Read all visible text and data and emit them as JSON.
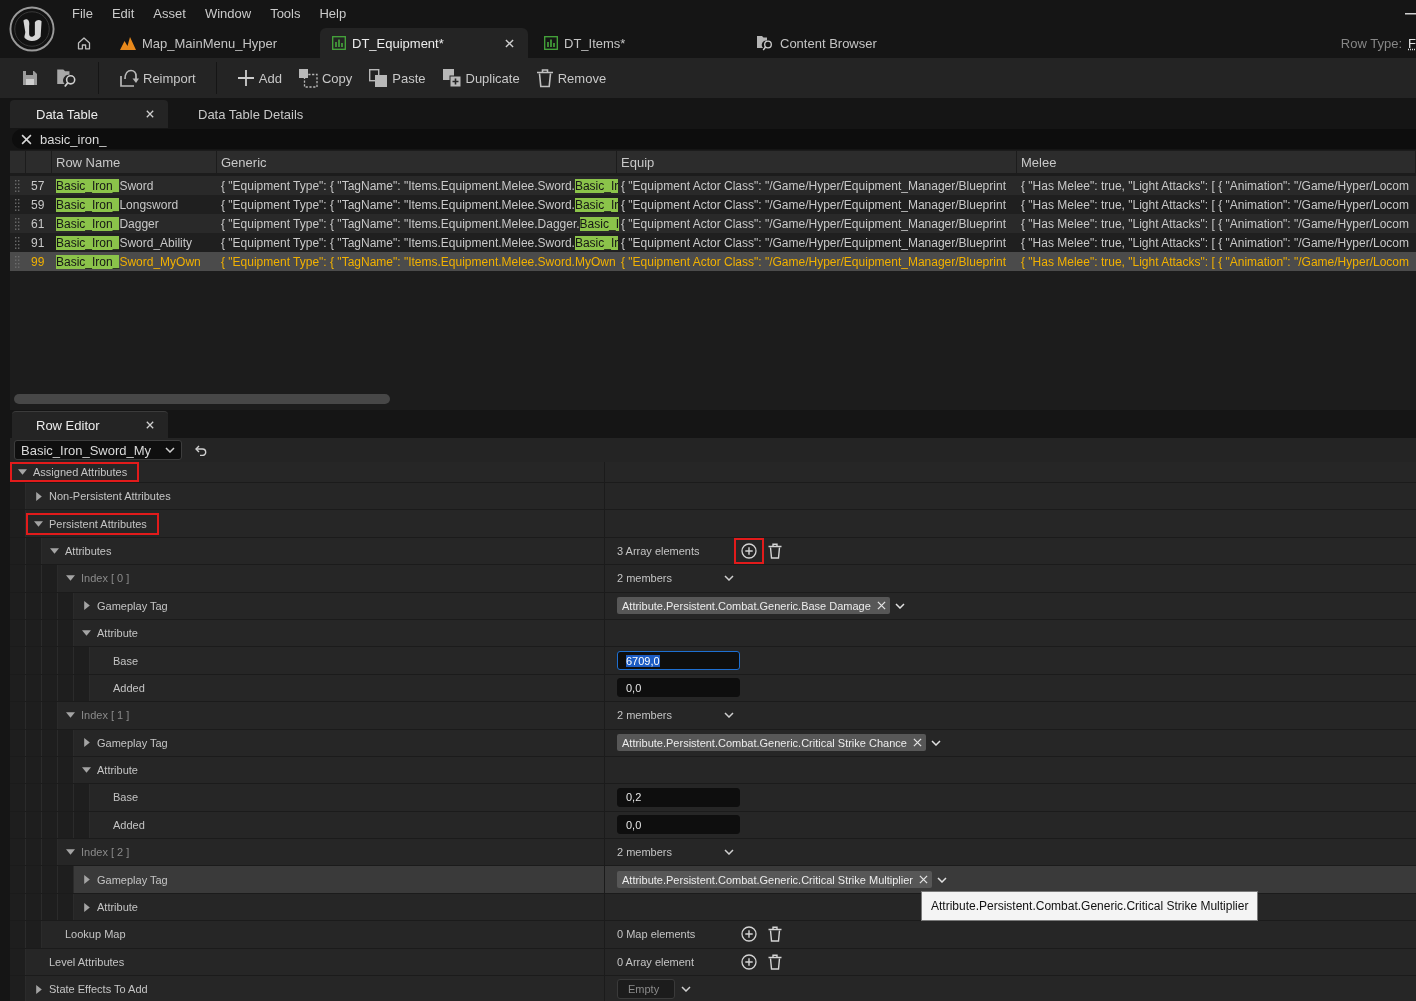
{
  "menu": [
    "File",
    "Edit",
    "Asset",
    "Window",
    "Tools",
    "Help"
  ],
  "document_tabs": [
    {
      "label": "Map_MainMenu_Hyper",
      "kind": "level",
      "selected": false
    },
    {
      "label": "DT_Equipment*",
      "kind": "data_table",
      "selected": true
    },
    {
      "label": "DT_Items*",
      "kind": "data_table",
      "selected": false
    },
    {
      "label": "Content Browser",
      "kind": "browser",
      "selected": false
    }
  ],
  "row_type": {
    "label": "Row Type:",
    "value": "F"
  },
  "toolbar": {
    "groups": [
      [
        {
          "kind": "save"
        },
        {
          "kind": "browse"
        }
      ],
      [
        {
          "kind": "reimport",
          "label": "Reimport"
        }
      ],
      [
        {
          "kind": "add",
          "label": "Add"
        },
        {
          "kind": "copy",
          "label": "Copy"
        },
        {
          "kind": "paste",
          "label": "Paste"
        },
        {
          "kind": "duplicate",
          "label": "Duplicate"
        },
        {
          "kind": "remove",
          "label": "Remove"
        }
      ]
    ]
  },
  "panel_tabs": [
    {
      "label": "Data Table",
      "selected": true
    },
    {
      "label": "Data Table Details",
      "selected": false
    }
  ],
  "search": {
    "value": "basic_iron_"
  },
  "table": {
    "columns": [
      "Row Name",
      "Generic",
      "Equip",
      "Melee"
    ],
    "rows": [
      {
        "number": "57",
        "row_name": [
          {
            "text": "Basic_Iron_",
            "match": true
          },
          {
            "text": "Sword",
            "match": false
          }
        ],
        "generic": [
          {
            "text": "{ \"Equipment Type\": { \"TagName\": \"Items.Equipment.Melee.Sword.",
            "match": false
          },
          {
            "text": "Basic_Ir",
            "match": true
          }
        ],
        "equip": "{ \"Equipment Actor Class\": \"/Game/Hyper/Equipment_Manager/Blueprint",
        "melee": "{ \"Has Melee\": true, \"Light Attacks\": [ { \"Animation\": \"/Game/Hyper/Locom",
        "selected": false
      },
      {
        "number": "59",
        "row_name": [
          {
            "text": "Basic_Iron_",
            "match": true
          },
          {
            "text": "Longsword",
            "match": false
          }
        ],
        "generic": [
          {
            "text": "{ \"Equipment Type\": { \"TagName\": \"Items.Equipment.Melee.Sword.",
            "match": false
          },
          {
            "text": "Basic_Ir",
            "match": true
          }
        ],
        "equip": "{ \"Equipment Actor Class\": \"/Game/Hyper/Equipment_Manager/Blueprint",
        "melee": "{ \"Has Melee\": true, \"Light Attacks\": [ { \"Animation\": \"/Game/Hyper/Locom",
        "selected": false
      },
      {
        "number": "61",
        "row_name": [
          {
            "text": "Basic_Iron_",
            "match": true
          },
          {
            "text": "Dagger",
            "match": false
          }
        ],
        "generic": [
          {
            "text": "{ \"Equipment Type\": { \"TagName\": \"Items.Equipment.Melee.Dagger.",
            "match": false
          },
          {
            "text": "Basic_I",
            "match": true
          }
        ],
        "equip": "{ \"Equipment Actor Class\": \"/Game/Hyper/Equipment_Manager/Blueprint",
        "melee": "{ \"Has Melee\": true, \"Light Attacks\": [ { \"Animation\": \"/Game/Hyper/Locom",
        "selected": false
      },
      {
        "number": "91",
        "row_name": [
          {
            "text": "Basic_Iron_",
            "match": true
          },
          {
            "text": "Sword_Ability",
            "match": false
          }
        ],
        "generic": [
          {
            "text": "{ \"Equipment Type\": { \"TagName\": \"Items.Equipment.Melee.Sword.",
            "match": false
          },
          {
            "text": "Basic_Ir",
            "match": true
          }
        ],
        "equip": "{ \"Equipment Actor Class\": \"/Game/Hyper/Equipment_Manager/Blueprint",
        "melee": "{ \"Has Melee\": true, \"Light Attacks\": [ { \"Animation\": \"/Game/Hyper/Locom",
        "selected": false
      },
      {
        "number": "99",
        "row_name": [
          {
            "text": "Basic_Iron_",
            "match": true
          },
          {
            "text": "Sword_MyOwn",
            "match": false
          }
        ],
        "generic": [
          {
            "text": "{ \"Equipment Type\": { \"TagName\": \"Items.Equipment.Melee.Sword.MyOwn",
            "match": false
          }
        ],
        "equip": "{ \"Equipment Actor Class\": \"/Game/Hyper/Equipment_Manager/Blueprint",
        "melee": "{ \"Has Melee\": true, \"Light Attacks\": [ { \"Animation\": \"/Game/Hyper/Locom",
        "selected": true
      }
    ]
  },
  "row_editor": {
    "tab": "Row Editor",
    "row_selector": "Basic_Iron_Sword_My",
    "properties": [
      {
        "name": "Assigned Attributes",
        "expanded": true,
        "outlined": true,
        "children": [
          {
            "name": "Non-Persistent Attributes",
            "expanded": false
          },
          {
            "name": "Persistent Attributes",
            "expanded": true,
            "outlined": true,
            "children": [
              {
                "name": "Attributes",
                "expanded": true,
                "value": {
                  "kind": "array",
                  "text": "3 Array elements",
                  "outlined": true
                },
                "children": [
                  {
                    "name": "Index [ 0 ]",
                    "muted": true,
                    "expanded": true,
                    "value": {
                      "kind": "members",
                      "text": "2 members"
                    },
                    "children": [
                      {
                        "name": "Gameplay Tag",
                        "expanded": false,
                        "value": {
                          "kind": "tag",
                          "text": "Attribute.Persistent.Combat.Generic.Base Damage"
                        }
                      },
                      {
                        "name": "Attribute",
                        "expanded": true,
                        "children": [
                          {
                            "name": "Base",
                            "value": {
                              "kind": "number",
                              "text": "6709,0",
                              "focused": true
                            }
                          },
                          {
                            "name": "Added",
                            "value": {
                              "kind": "number",
                              "text": "0,0",
                              "focused": false
                            }
                          }
                        ]
                      }
                    ]
                  },
                  {
                    "name": "Index [ 1 ]",
                    "muted": true,
                    "expanded": true,
                    "value": {
                      "kind": "members",
                      "text": "2 members"
                    },
                    "children": [
                      {
                        "name": "Gameplay Tag",
                        "expanded": false,
                        "value": {
                          "kind": "tag",
                          "text": "Attribute.Persistent.Combat.Generic.Critical Strike Chance"
                        }
                      },
                      {
                        "name": "Attribute",
                        "expanded": true,
                        "children": [
                          {
                            "name": "Base",
                            "value": {
                              "kind": "number",
                              "text": "0,2",
                              "focused": false
                            }
                          },
                          {
                            "name": "Added",
                            "value": {
                              "kind": "number",
                              "text": "0,0",
                              "focused": false
                            }
                          }
                        ]
                      }
                    ]
                  },
                  {
                    "name": "Index [ 2 ]",
                    "muted": true,
                    "expanded": true,
                    "value": {
                      "kind": "members",
                      "text": "2 members"
                    },
                    "children": [
                      {
                        "name": "Gameplay Tag",
                        "expanded": false,
                        "hovered": true,
                        "value": {
                          "kind": "tag",
                          "text": "Attribute.Persistent.Combat.Generic.Critical Strike Multiplier",
                          "tooltip": "Attribute.Persistent.Combat.Generic.Critical Strike Multiplier"
                        }
                      },
                      {
                        "name": "Attribute",
                        "expanded": false
                      }
                    ]
                  }
                ]
              },
              {
                "name": "Lookup Map",
                "value": {
                  "kind": "array",
                  "text": "0 Map elements"
                }
              }
            ]
          },
          {
            "name": "Level Attributes",
            "value": {
              "kind": "array",
              "text": "0 Array element"
            }
          },
          {
            "name": "State Effects To Add",
            "expanded": false,
            "value": {
              "kind": "dropdown",
              "text": "Empty"
            }
          }
        ]
      }
    ]
  }
}
